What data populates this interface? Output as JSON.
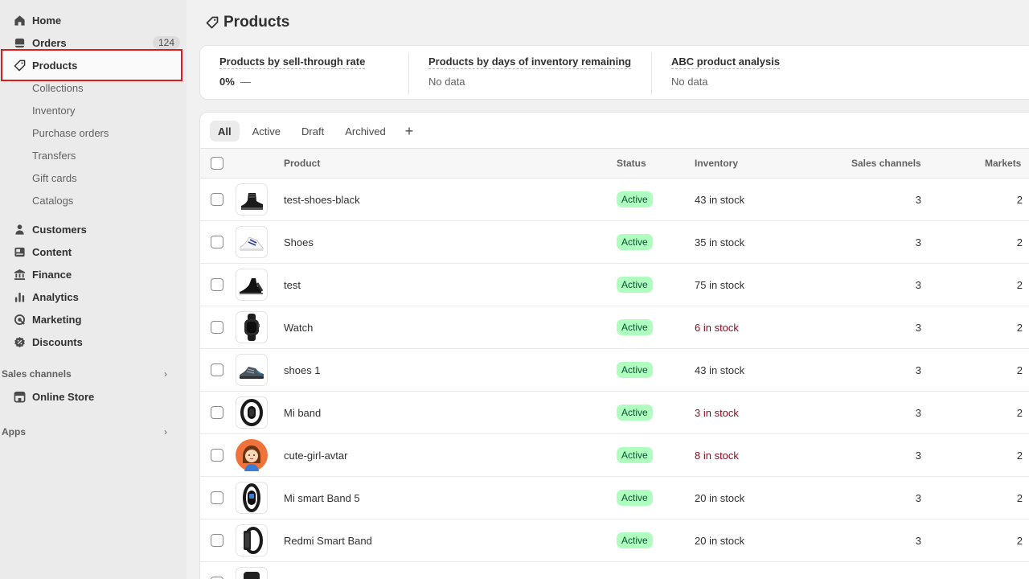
{
  "sidebar": {
    "items": [
      {
        "label": "Home",
        "icon": "home-icon"
      },
      {
        "label": "Orders",
        "icon": "orders-icon",
        "badge": "124"
      },
      {
        "label": "Products",
        "icon": "tag-icon"
      },
      {
        "label": "Collections"
      },
      {
        "label": "Inventory"
      },
      {
        "label": "Purchase orders"
      },
      {
        "label": "Transfers"
      },
      {
        "label": "Gift cards"
      },
      {
        "label": "Catalogs"
      },
      {
        "label": "Customers",
        "icon": "person-icon"
      },
      {
        "label": "Content",
        "icon": "content-icon"
      },
      {
        "label": "Finance",
        "icon": "bank-icon"
      },
      {
        "label": "Analytics",
        "icon": "bar-chart-icon"
      },
      {
        "label": "Marketing",
        "icon": "target-icon"
      },
      {
        "label": "Discounts",
        "icon": "discount-icon"
      }
    ],
    "sales_channels_title": "Sales channels",
    "online_store_label": "Online Store",
    "apps_title": "Apps"
  },
  "header": {
    "title": "Products"
  },
  "metrics": [
    {
      "title": "Products by sell-through rate",
      "value": "0%",
      "trend": "—"
    },
    {
      "title": "Products by days of inventory remaining",
      "value": "No data"
    },
    {
      "title": "ABC product analysis",
      "value": "No data"
    }
  ],
  "tabs": [
    "All",
    "Active",
    "Draft",
    "Archived"
  ],
  "table": {
    "headers": {
      "product": "Product",
      "status": "Status",
      "inventory": "Inventory",
      "channels": "Sales channels",
      "markets": "Markets"
    },
    "rows": [
      {
        "name": "test-shoes-black",
        "status": "Active",
        "inventory": "43 in stock",
        "channels": "3",
        "markets": "2"
      },
      {
        "name": "Shoes",
        "status": "Active",
        "inventory": "35 in stock",
        "channels": "3",
        "markets": "2"
      },
      {
        "name": "test",
        "status": "Active",
        "inventory": "75 in stock",
        "channels": "3",
        "markets": "2"
      },
      {
        "name": "Watch",
        "status": "Active",
        "inventory": "6 in stock",
        "channels": "3",
        "markets": "2"
      },
      {
        "name": "shoes 1",
        "status": "Active",
        "inventory": "43 in stock",
        "channels": "3",
        "markets": "2"
      },
      {
        "name": "Mi band",
        "status": "Active",
        "inventory": "3 in stock",
        "channels": "3",
        "markets": "2"
      },
      {
        "name": "cute-girl-avtar",
        "status": "Active",
        "inventory": "8 in stock",
        "channels": "3",
        "markets": "2"
      },
      {
        "name": "Mi smart Band 5",
        "status": "Active",
        "inventory": "20 in stock",
        "channels": "3",
        "markets": "2"
      },
      {
        "name": "Redmi Smart Band",
        "status": "Active",
        "inventory": "20 in stock",
        "channels": "3",
        "markets": "2"
      }
    ]
  },
  "colors": {
    "active_badge_bg": "#affebf",
    "low_stock_text": "#8e0b21",
    "selection_outline": "#e01b1b"
  }
}
